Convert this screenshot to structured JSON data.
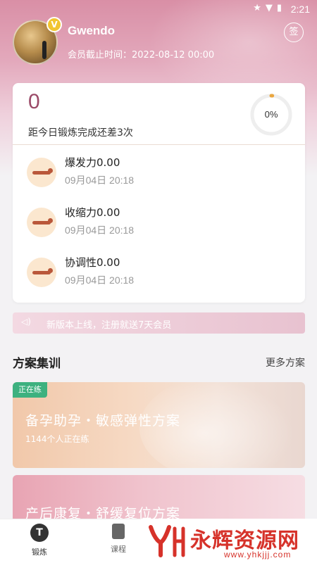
{
  "status_bar": {
    "time": "2:21"
  },
  "profile": {
    "username": "Gwendo",
    "expiry": "会员截止时间：2022-08-12 00:00",
    "sign_label": "签",
    "vip_badge": "V"
  },
  "summary": {
    "count": "0",
    "remaining_text": "距今日锻炼完成还差3次",
    "progress_label": "0%",
    "progress_value": 0
  },
  "metrics": [
    {
      "name": "爆发力0.00",
      "time": "09月04日 20:18"
    },
    {
      "name": "收缩力0.00",
      "time": "09月04日 20:18"
    },
    {
      "name": "协调性0.00",
      "time": "09月04日 20:18"
    }
  ],
  "notice": {
    "text": "新版本上线，注册就送7天会员"
  },
  "section": {
    "title": "方案集训",
    "more": "更多方案"
  },
  "plans": [
    {
      "tag": "正在练",
      "title": "备孕助孕・敏感弹性方案",
      "subtitle": "1144个人正在练"
    },
    {
      "title": "产后康复・舒缓复位方案"
    }
  ],
  "tabs": [
    {
      "label": "锻炼",
      "icon": "dumbbell-icon"
    },
    {
      "label": "课程",
      "icon": "book-icon"
    }
  ],
  "watermark": {
    "brand": "永辉资源网",
    "url": "www.yhkjjj.com"
  },
  "colors": {
    "accent": "#9b4a68",
    "tag_green": "#3db17f",
    "progress_orange": "#e9a640"
  }
}
